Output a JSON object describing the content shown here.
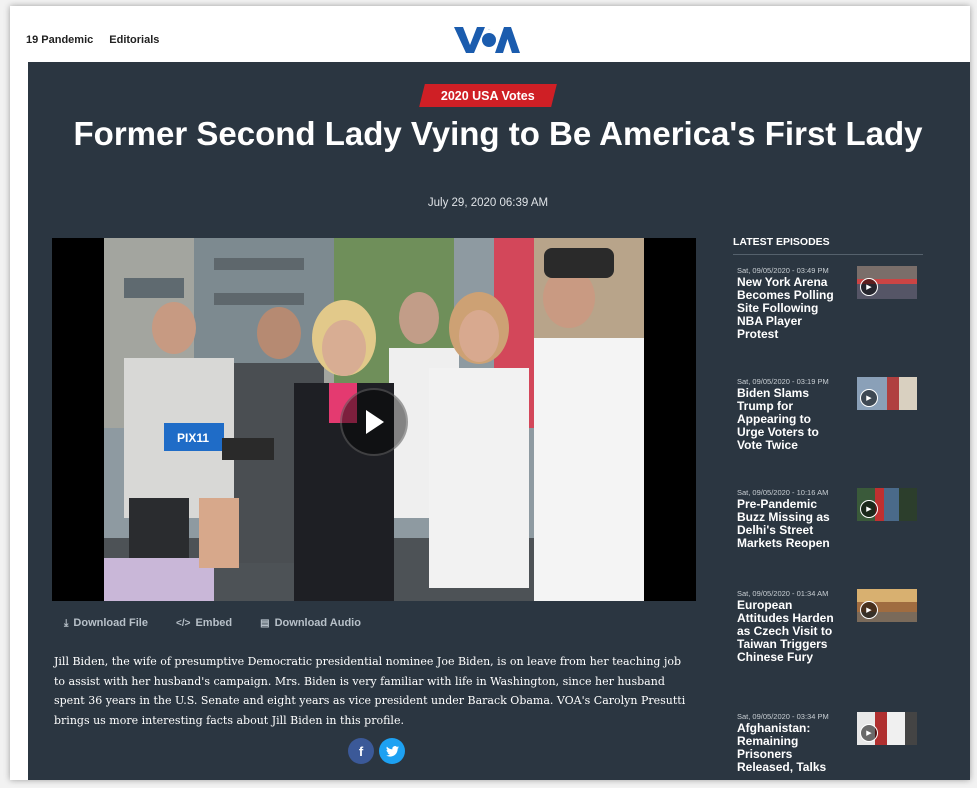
{
  "nav": {
    "items": [
      "19 Pandemic",
      "Editorials"
    ],
    "logo": "VOA"
  },
  "article": {
    "category": "2020 USA Votes",
    "title": "Former Second Lady Vying to Be America's First Lady",
    "date": "July 29, 2020 06:39 AM",
    "tools": {
      "download_file": "Download File",
      "embed": "Embed",
      "download_audio": "Download Audio"
    },
    "description": "Jill Biden, the wife of presumptive Democratic presidential nominee Joe Biden, is on leave from her teaching job to assist with her husband's campaign. Mrs. Biden is very familiar with life in Washington, since her husband spent 36 years in the U.S. Senate and eight years as vice president under Barack Obama.  VOA's Carolyn Presutti brings us more interesting facts about Jill Biden in this profile.",
    "mic_label": "PIX11"
  },
  "share": {
    "facebook": "f",
    "twitter": "t"
  },
  "sidebar": {
    "title": "LATEST EPISODES",
    "episodes": [
      {
        "time": "Sat, 09/05/2020 - 03:49 PM",
        "title": "New York Arena Becomes Polling Site Following NBA Player Protest"
      },
      {
        "time": "Sat, 09/05/2020 - 03:19 PM",
        "title": "Biden Slams Trump for Appearing to Urge Voters to Vote Twice"
      },
      {
        "time": "Sat, 09/05/2020 - 10:16 AM",
        "title": "Pre-Pandemic Buzz Missing as Delhi's Street Markets Reopen"
      },
      {
        "time": "Sat, 09/05/2020 - 01:34 AM",
        "title": "European Attitudes Harden as Czech Visit to Taiwan Triggers Chinese Fury"
      },
      {
        "time": "Sat, 09/05/2020 - 03:34 PM",
        "title": "Afghanistan: Remaining Prisoners Released, Talks"
      }
    ]
  },
  "colors": {
    "background": "#2b3641",
    "badge": "#cf1f25",
    "brand_blue": "#1b5cae"
  }
}
